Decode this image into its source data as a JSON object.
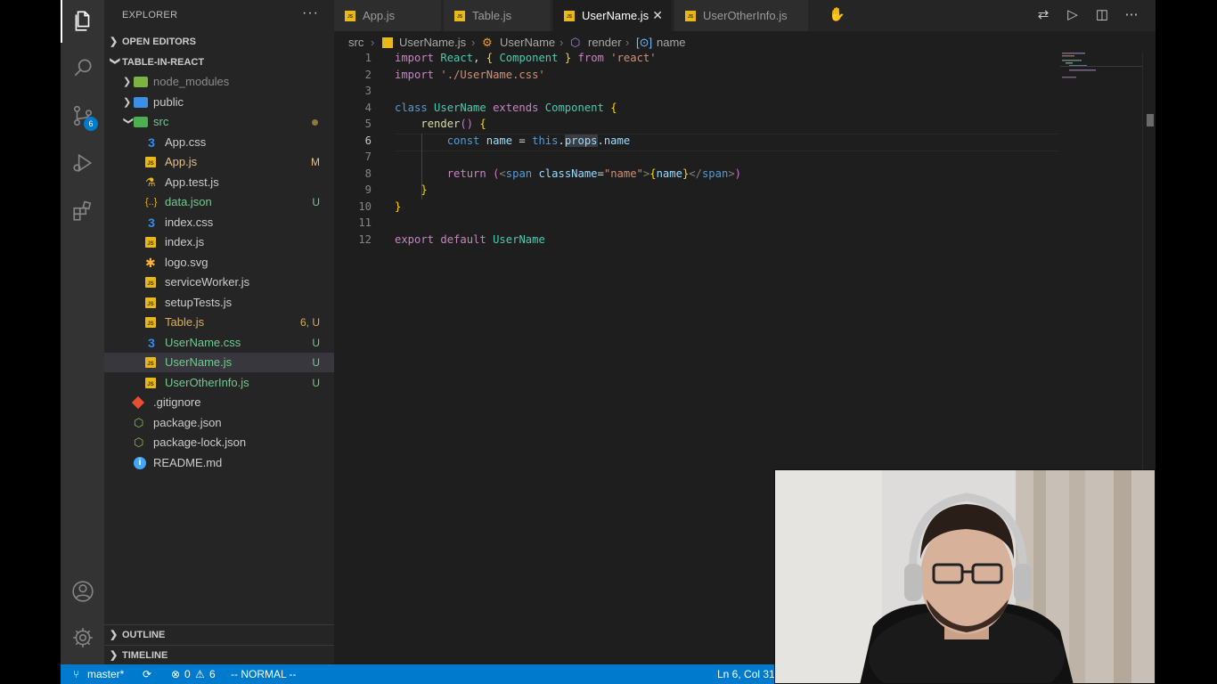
{
  "activity_bar": {
    "items": [
      {
        "icon": "explorer-icon",
        "active": true
      },
      {
        "icon": "search-icon"
      },
      {
        "icon": "source-control-icon",
        "badge": "6"
      },
      {
        "icon": "run-debug-icon"
      },
      {
        "icon": "extensions-icon"
      }
    ],
    "bottom": [
      {
        "icon": "account-icon"
      },
      {
        "icon": "settings-gear-icon"
      }
    ]
  },
  "sidebar": {
    "title": "EXPLORER",
    "more": "···",
    "open_editors": "OPEN EDITORS",
    "project": "TABLE-IN-REACT",
    "tree": [
      {
        "label": "node_modules",
        "type": "folder",
        "status": "",
        "color": "dim"
      },
      {
        "label": "public",
        "type": "folder",
        "status": ""
      },
      {
        "label": "src",
        "type": "folder-open",
        "status": "dot",
        "color": "untr"
      },
      {
        "label": "App.css",
        "type": "css",
        "status": ""
      },
      {
        "label": "App.js",
        "type": "js",
        "status": "M",
        "color": "mod"
      },
      {
        "label": "App.test.js",
        "type": "test",
        "status": ""
      },
      {
        "label": "data.json",
        "type": "json",
        "status": "U",
        "color": "untr"
      },
      {
        "label": "index.css",
        "type": "css",
        "status": ""
      },
      {
        "label": "index.js",
        "type": "js",
        "status": ""
      },
      {
        "label": "logo.svg",
        "type": "svg",
        "status": ""
      },
      {
        "label": "serviceWorker.js",
        "type": "js",
        "status": ""
      },
      {
        "label": "setupTests.js",
        "type": "js",
        "status": ""
      },
      {
        "label": "Table.js",
        "type": "js",
        "status": "6, U",
        "color": "err"
      },
      {
        "label": "UserName.css",
        "type": "css",
        "status": "U",
        "color": "untr"
      },
      {
        "label": "UserName.js",
        "type": "js",
        "status": "U",
        "color": "untr",
        "selected": true
      },
      {
        "label": "UserOtherInfo.js",
        "type": "js",
        "status": "U",
        "color": "untr"
      },
      {
        "label": ".gitignore",
        "type": "git",
        "status": ""
      },
      {
        "label": "package.json",
        "type": "npm",
        "status": ""
      },
      {
        "label": "package-lock.json",
        "type": "npm",
        "status": ""
      },
      {
        "label": "README.md",
        "type": "info",
        "status": ""
      }
    ],
    "outline": "OUTLINE",
    "timeline": "TIMELINE"
  },
  "tabs": [
    {
      "label": "App.js",
      "active": false
    },
    {
      "label": "Table.js",
      "active": false
    },
    {
      "label": "UserName.js",
      "active": true,
      "close": "✕"
    },
    {
      "label": "UserOtherInfo.js",
      "active": false
    }
  ],
  "breadcrumb": {
    "folder": "src",
    "file": "UserName.js",
    "class": "UserName",
    "method": "render",
    "variable": "name"
  },
  "editor": {
    "current_line": 6,
    "lines": [
      "import React, { Component } from 'react'",
      "import './UserName.css'",
      "",
      "class UserName extends Component {",
      "    render() {",
      "        const name = this.props.name",
      "",
      "        return (<span className=\"name\">{name}</span>)",
      "    }",
      "}",
      "",
      "export default UserName"
    ]
  },
  "statusbar": {
    "branch": "master*",
    "sync_icon": "sync-icon",
    "errors": "0",
    "warnings": "6",
    "mode": "-- NORMAL --",
    "cursor": "Ln 6, Col 31"
  },
  "colors": {
    "accent": "#007acc",
    "modified": "#e2c08d",
    "untracked": "#73c991"
  }
}
